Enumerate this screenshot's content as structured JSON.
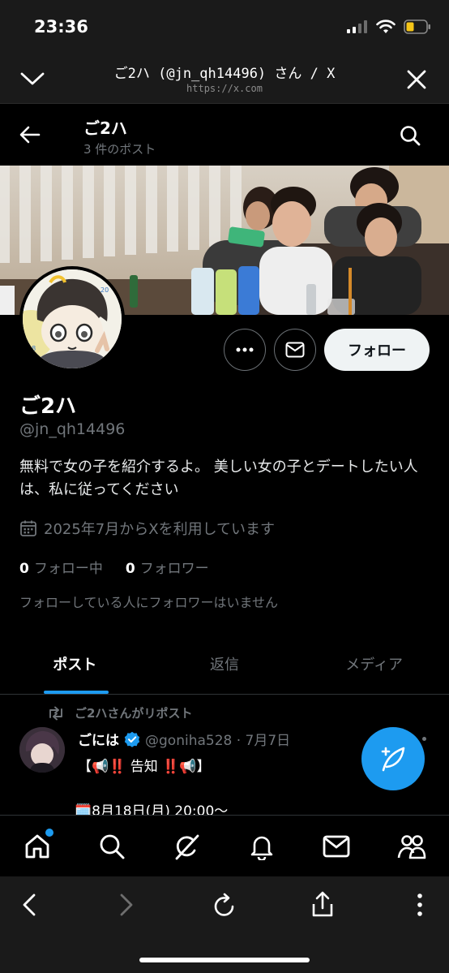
{
  "status_bar": {
    "time": "23:36"
  },
  "browser": {
    "title": "ご2ハ (@jn_qh14496) さん / X",
    "url": "https://x.com"
  },
  "header": {
    "name": "ご2ハ",
    "post_count": "3 件のポスト"
  },
  "profile": {
    "name": "ご2ハ",
    "handle": "@jn_qh14496",
    "bio": "無料で女の子を紹介するよ。 美しい女の子とデートしたい人は、私に従ってください",
    "joined": "2025年7月からXを利用しています",
    "following_count": "0",
    "following_label": "フォロー中",
    "followers_count": "0",
    "followers_label": "フォロワー",
    "no_followers_text": "フォローしている人にフォロワーはいません",
    "follow_button": "フォロー"
  },
  "tabs": [
    {
      "label": "ポスト",
      "active": true
    },
    {
      "label": "返信",
      "active": false
    },
    {
      "label": "メディア",
      "active": false
    }
  ],
  "post": {
    "repost_label": "ご2ハさんがリポスト",
    "author": "ごには",
    "handle_date": "@goniha528 · 7月7日",
    "line1": "【📢‼️ 告知 ‼️📢】",
    "line2": "🗓️8月18日(月) 20:00〜"
  },
  "colors": {
    "accent": "#1d9bf0",
    "background": "#000000",
    "muted_text": "#71767b"
  },
  "icons": [
    "chevron-down-icon",
    "close-icon",
    "back-arrow-icon",
    "search-icon",
    "more-icon",
    "mail-icon",
    "calendar-icon",
    "repost-icon",
    "verified-badge-icon",
    "compose-icon",
    "home-icon",
    "grok-icon",
    "bell-icon",
    "communities-icon",
    "share-icon",
    "reload-icon"
  ]
}
